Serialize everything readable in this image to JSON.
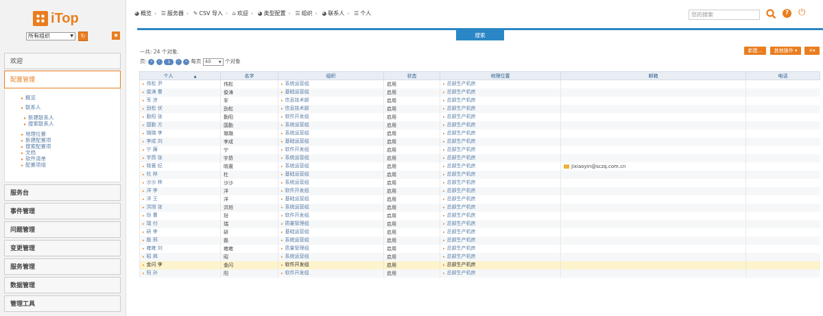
{
  "logo_text": "iTop",
  "org_select": "所有组织",
  "nav": {
    "welcome": "欢迎",
    "config": "配置管理",
    "config_items": [
      "概览",
      "联系人",
      "新建联系人",
      "搜索联系人",
      "地理位置",
      "新建配置项",
      "搜索配置项",
      "文档",
      "软件清单",
      "配置项组"
    ],
    "service_desk": "服务台",
    "incident": "事件管理",
    "problem": "问题管理",
    "change": "变更管理",
    "service_mgmt": "服务管理",
    "data_mgmt": "数据管理",
    "admin_tools": "管理工具"
  },
  "breadcrumb": [
    "概览",
    "服务器",
    "CSV 导入",
    "欢迎",
    "类型配置",
    "组织",
    "联系人",
    "个人"
  ],
  "search": {
    "placeholder": "您的搜索"
  },
  "search_tab": "搜索",
  "count_text": "一共: 24 个对象.",
  "pager": {
    "page_label": "页:",
    "current": "1",
    "per_page_label": "每页",
    "per_page": "40",
    "objects_label": "个对象"
  },
  "actions": {
    "new": "新建...",
    "other": "其他操作 ▾",
    "tools": "✕▾"
  },
  "table": {
    "headers": [
      "个人",
      "名字",
      "组织",
      "状态",
      "地理位置",
      "邮箱",
      "电话"
    ],
    "rows": [
      [
        "伟松 尹",
        "伟松",
        "系统运营组",
        "启用",
        "总部生产机房",
        "",
        ""
      ],
      [
        "俊涛 曹",
        "俊涛",
        "基础运营组",
        "启用",
        "总部生产机房",
        "",
        ""
      ],
      [
        "军 凉",
        "军",
        "信息技术部",
        "启用",
        "总部生产机房",
        "",
        ""
      ],
      [
        "劲松 伏",
        "劲松",
        "信息技术部",
        "启用",
        "总部生产机房",
        "",
        ""
      ],
      [
        "勤阳 张",
        "勤阳",
        "软件开发组",
        "启用",
        "总部生产机房",
        "",
        ""
      ],
      [
        "国勤 方",
        "国勤",
        "系统运营组",
        "启用",
        "总部生产机房",
        "",
        ""
      ],
      [
        "璐璐 李",
        "璐璐",
        "系统运营组",
        "启用",
        "总部生产机房",
        "",
        ""
      ],
      [
        "李成 刘",
        "李成",
        "基础运营组",
        "启用",
        "总部生产机房",
        "",
        ""
      ],
      [
        "宁 廉",
        "宁",
        "软件开发组",
        "启用",
        "总部生产机房",
        "",
        ""
      ],
      [
        "宇昂 张",
        "宇昂",
        "系统运营组",
        "启用",
        "总部生产机房",
        "",
        ""
      ],
      [
        "晓寰 纪",
        "晓寰",
        "系统运营组",
        "启用",
        "总部生产机房",
        "jixiaoyin@sczq.com.cn",
        ""
      ],
      [
        "杜 林",
        "杜",
        "基础运营组",
        "启用",
        "总部生产机房",
        "",
        ""
      ],
      [
        "沙沙 林",
        "沙沙",
        "系统运营组",
        "启用",
        "总部生产机房",
        "",
        ""
      ],
      [
        "洋 李",
        "洋",
        "软件开发组",
        "启用",
        "总部生产机房",
        "",
        ""
      ],
      [
        "洋 王",
        "洋",
        "基础运营组",
        "启用",
        "总部生产机房",
        "",
        ""
      ],
      [
        "洪旭 张",
        "洪旭",
        "系统运营组",
        "启用",
        "总部生产机房",
        "",
        ""
      ],
      [
        "玢 曹",
        "玢",
        "软件开发组",
        "启用",
        "总部生产机房",
        "",
        ""
      ],
      [
        "瑞 付",
        "瑞",
        "质量管理组",
        "启用",
        "总部生产机房",
        "",
        ""
      ],
      [
        "研 李",
        "研",
        "基础运营组",
        "启用",
        "总部生产机房",
        "",
        ""
      ],
      [
        "磊 邢",
        "磊",
        "系统运营组",
        "启用",
        "总部生产机房",
        "",
        ""
      ],
      [
        "雍雍 刘",
        "雍雍",
        "质量管理组",
        "启用",
        "总部生产机房",
        "",
        ""
      ],
      [
        "昭 揭",
        "昭",
        "系统运营组",
        "启用",
        "总部生产机房",
        "",
        ""
      ],
      [
        "金闪 李",
        "金闪",
        "软件开发组",
        "启用",
        "总部生产机房",
        "",
        ""
      ],
      [
        "阳 孙",
        "阳",
        "软件开发组",
        "启用",
        "总部生产机房",
        "",
        ""
      ]
    ],
    "highlight_row": 22
  },
  "colors": {
    "accent": "#ea7d1e",
    "blue": "#2b86c5"
  }
}
